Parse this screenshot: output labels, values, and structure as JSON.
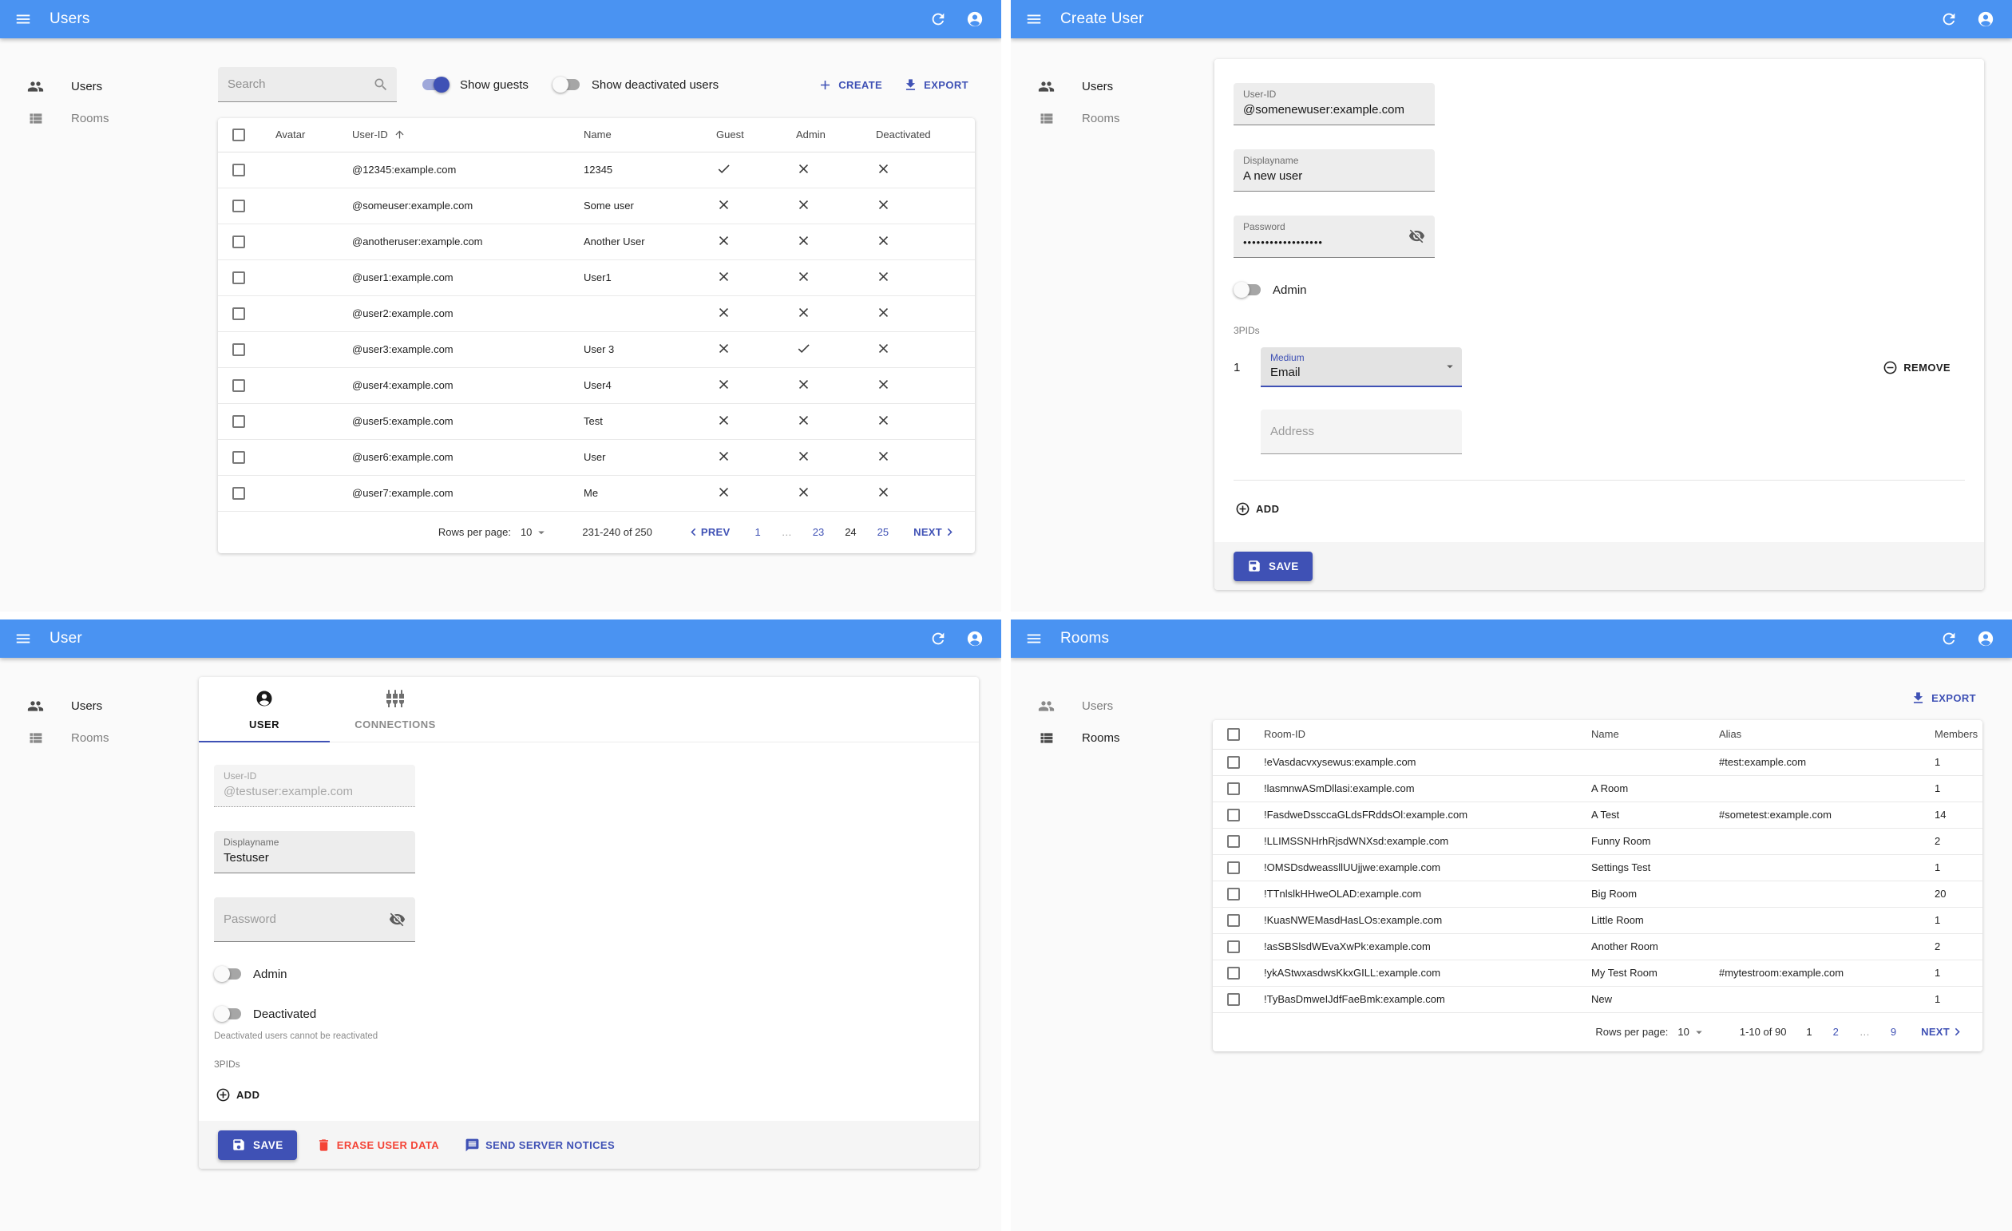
{
  "colors": {
    "appbar": "#4a93f2",
    "primary": "#3f51b5",
    "danger": "#f44336",
    "switch_track_on": "#9fa8da"
  },
  "icons": {
    "appbar": [
      "menu-icon",
      "refresh-icon",
      "account-circle-icon"
    ],
    "sidebar": [
      "users-icon",
      "rooms-list-icon"
    ],
    "list": [
      "search-icon",
      "plus-icon",
      "download-icon",
      "sort-up-icon",
      "check-icon",
      "cross-icon",
      "caret-down-icon",
      "chevron-left-icon",
      "chevron-right-icon"
    ],
    "forms": [
      "eye-off-icon",
      "remove-circle-icon",
      "add-circle-icon",
      "save-icon",
      "trash-icon",
      "message-icon",
      "person-circle-icon",
      "sliders-icon"
    ]
  },
  "users_panel": {
    "title": "Users",
    "nav": [
      "Users",
      "Rooms"
    ],
    "search_placeholder": "Search",
    "show_guests_label": "Show guests",
    "show_guests_on": true,
    "show_deactivated_label": "Show deactivated users",
    "show_deactivated_on": false,
    "create_label": "CREATE",
    "export_label": "EXPORT",
    "columns": {
      "avatar": "Avatar",
      "user_id": "User-ID",
      "name": "Name",
      "guest": "Guest",
      "admin": "Admin",
      "deactivated": "Deactivated"
    },
    "rows": [
      {
        "user_id": "@12345:example.com",
        "name": "12345",
        "guest": true,
        "admin": false,
        "deactivated": false
      },
      {
        "user_id": "@someuser:example.com",
        "name": "Some user",
        "guest": false,
        "admin": false,
        "deactivated": false
      },
      {
        "user_id": "@anotheruser:example.com",
        "name": "Another User",
        "guest": false,
        "admin": false,
        "deactivated": false
      },
      {
        "user_id": "@user1:example.com",
        "name": "User1",
        "guest": false,
        "admin": false,
        "deactivated": false
      },
      {
        "user_id": "@user2:example.com",
        "name": "",
        "guest": false,
        "admin": false,
        "deactivated": false
      },
      {
        "user_id": "@user3:example.com",
        "name": "User 3",
        "guest": false,
        "admin": true,
        "deactivated": false
      },
      {
        "user_id": "@user4:example.com",
        "name": "User4",
        "guest": false,
        "admin": false,
        "deactivated": false
      },
      {
        "user_id": "@user5:example.com",
        "name": "Test",
        "guest": false,
        "admin": false,
        "deactivated": false
      },
      {
        "user_id": "@user6:example.com",
        "name": "User",
        "guest": false,
        "admin": false,
        "deactivated": false
      },
      {
        "user_id": "@user7:example.com",
        "name": "Me",
        "guest": false,
        "admin": false,
        "deactivated": false
      }
    ],
    "footer": {
      "rows_per_page_label": "Rows per page:",
      "rows_per_page": "10",
      "range": "231-240 of 250",
      "prev_label": "PREV",
      "next_label": "NEXT",
      "pages": [
        {
          "label": "1",
          "state": "link"
        },
        {
          "label": "…",
          "state": "ellipsis"
        },
        {
          "label": "23",
          "state": "link"
        },
        {
          "label": "24",
          "state": "current"
        },
        {
          "label": "25",
          "state": "link"
        }
      ]
    }
  },
  "create_panel": {
    "title": "Create User",
    "nav": [
      "Users",
      "Rooms"
    ],
    "user_id_label": "User-ID",
    "user_id_value": "@somenewuser:example.com",
    "displayname_label": "Displayname",
    "displayname_value": "A new user",
    "password_label": "Password",
    "password_value": "••••••••••••••••••",
    "admin_label": "Admin",
    "admin_on": false,
    "pids_label": "3PIDs",
    "pid_index": "1",
    "medium_label": "Medium",
    "medium_value": "Email",
    "remove_label": "REMOVE",
    "address_placeholder": "Address",
    "add_label": "ADD",
    "save_label": "SAVE"
  },
  "user_panel": {
    "title": "User",
    "nav": [
      "Users",
      "Rooms"
    ],
    "tab_user": "USER",
    "tab_connections": "CONNECTIONS",
    "user_id_label": "User-ID",
    "user_id_value": "@testuser:example.com",
    "displayname_label": "Displayname",
    "displayname_value": "Testuser",
    "password_placeholder": "Password",
    "admin_label": "Admin",
    "admin_on": false,
    "deactivated_label": "Deactivated",
    "deactivated_on": false,
    "deactivated_helper": "Deactivated users cannot be reactivated",
    "pids_label": "3PIDs",
    "add_label": "ADD",
    "save_label": "SAVE",
    "erase_label": "ERASE USER DATA",
    "notices_label": "SEND SERVER NOTICES"
  },
  "rooms_panel": {
    "title": "Rooms",
    "nav": [
      "Users",
      "Rooms"
    ],
    "export_label": "EXPORT",
    "columns": {
      "room_id": "Room-ID",
      "name": "Name",
      "alias": "Alias",
      "members": "Members"
    },
    "rows": [
      {
        "room_id": "!eVasdacvxysewus:example.com",
        "name": "",
        "alias": "#test:example.com",
        "members": "1"
      },
      {
        "room_id": "!lasmnwASmDllasi:example.com",
        "name": "A Room",
        "alias": "",
        "members": "1"
      },
      {
        "room_id": "!FasdweDssccaGLdsFRddsOl:example.com",
        "name": "A Test",
        "alias": "#sometest:example.com",
        "members": "14"
      },
      {
        "room_id": "!LLIMSSNHrhRjsdWNXsd:example.com",
        "name": "Funny Room",
        "alias": "",
        "members": "2"
      },
      {
        "room_id": "!OMSDsdweassllUUjjwe:example.com",
        "name": "Settings Test",
        "alias": "",
        "members": "1"
      },
      {
        "room_id": "!TTnlslkHHweOLAD:example.com",
        "name": "Big Room",
        "alias": "",
        "members": "20"
      },
      {
        "room_id": "!KuasNWEMasdHasLOs:example.com",
        "name": "Little Room",
        "alias": "",
        "members": "1"
      },
      {
        "room_id": "!asSBSlsdWEvaXwPk:example.com",
        "name": "Another Room",
        "alias": "",
        "members": "2"
      },
      {
        "room_id": "!ykAStwxasdwsKkxGILL:example.com",
        "name": "My Test Room",
        "alias": "#mytestroom:example.com",
        "members": "1"
      },
      {
        "room_id": "!TyBasDmweIJdfFaeBmk:example.com",
        "name": "New",
        "alias": "",
        "members": "1"
      }
    ],
    "footer": {
      "rows_per_page_label": "Rows per page:",
      "rows_per_page": "10",
      "range": "1-10 of 90",
      "next_label": "NEXT",
      "pages": [
        {
          "label": "1",
          "state": "current"
        },
        {
          "label": "2",
          "state": "link"
        },
        {
          "label": "…",
          "state": "ellipsis"
        },
        {
          "label": "9",
          "state": "link"
        }
      ]
    }
  }
}
